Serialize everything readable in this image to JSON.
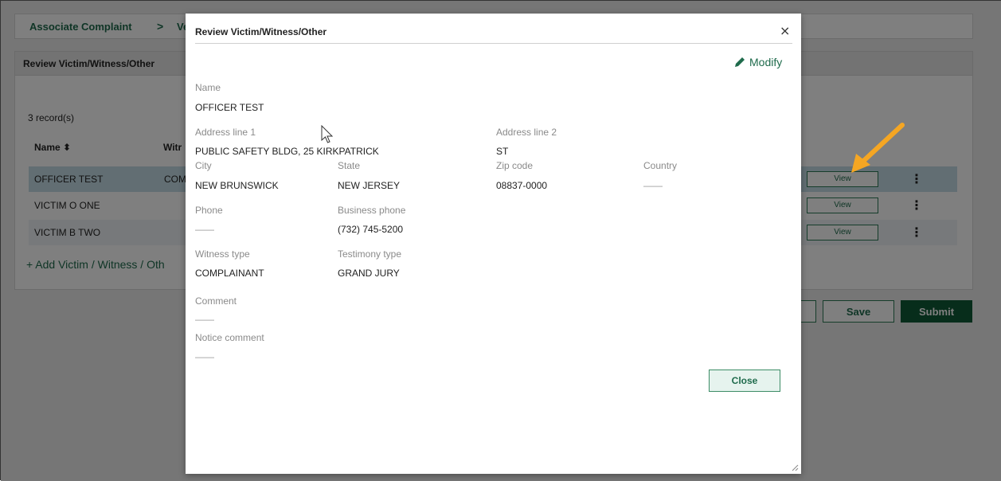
{
  "breadcrumb": {
    "item1": "Associate Complaint",
    "separator": ">",
    "item2": "Veri"
  },
  "panel": {
    "title": "Review Victim/Witness/Other",
    "record_count": "3 record(s)",
    "columns": {
      "name": "Name ⬍",
      "witness": "Witr"
    },
    "rows": [
      {
        "name": "OFFICER TEST",
        "witness": "COM",
        "view": "View",
        "more": "⋮"
      },
      {
        "name": "VICTIM O ONE",
        "witness": "",
        "view": "View",
        "more": "⋮"
      },
      {
        "name": "VICTIM B TWO",
        "witness": "",
        "view": "View",
        "more": "⋮"
      }
    ],
    "add_link": "+ Add Victim / Witness / Oth"
  },
  "actions": {
    "save": "Save",
    "submit": "Submit"
  },
  "modal": {
    "title": "Review Victim/Witness/Other",
    "close_x": "×",
    "modify": "Modify",
    "fields": {
      "name_label": "Name",
      "name_value": "OFFICER TEST",
      "address1_label": "Address line 1",
      "address1_value": "PUBLIC SAFETY BLDG, 25 KIRKPATRICK",
      "address2_label": "Address line 2",
      "address2_value": "ST",
      "city_label": "City",
      "city_value": "NEW BRUNSWICK",
      "state_label": "State",
      "state_value": "NEW JERSEY",
      "zip_label": "Zip code",
      "zip_value": "08837-0000",
      "country_label": "Country",
      "country_value": "——",
      "phone_label": "Phone",
      "phone_value": "——",
      "business_phone_label": "Business phone",
      "business_phone_value": "(732) 745-5200",
      "witness_type_label": "Witness type",
      "witness_type_value": "COMPLAINANT",
      "testimony_type_label": "Testimony type",
      "testimony_type_value": "GRAND JURY",
      "comment_label": "Comment",
      "comment_value": "——",
      "notice_comment_label": "Notice comment",
      "notice_comment_value": "——"
    },
    "close_button": "Close"
  },
  "colors": {
    "brand_green": "#1f6b4c",
    "submit_green": "#0f5a36",
    "selected_row": "#c5dde7",
    "annotation_arrow": "#f5a623"
  },
  "icons": {
    "modify": "pencil-icon",
    "close": "close-icon",
    "sort": "sort-icon",
    "more": "kebab-menu-icon",
    "resize": "resize-handle-icon",
    "pointer": "mouse-cursor-icon",
    "annotation": "annotation-arrow-icon"
  }
}
